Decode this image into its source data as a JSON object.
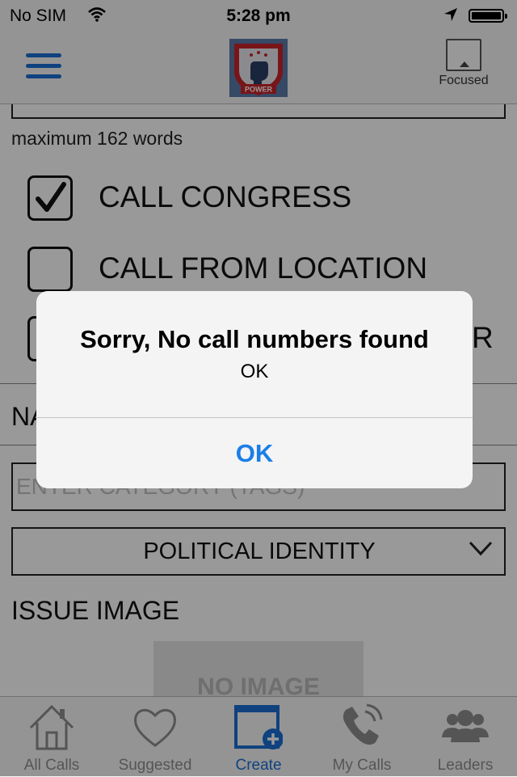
{
  "status_bar": {
    "carrier": "No SIM",
    "time": "5:28 pm"
  },
  "nav": {
    "logo_text": "POWER",
    "focused_label": "Focused"
  },
  "form": {
    "word_limit": "maximum 162 words",
    "checkboxes": [
      {
        "label": "CALL CONGRESS",
        "checked": true
      },
      {
        "label": "CALL FROM LOCATION",
        "checked": false
      },
      {
        "label": "R",
        "checked": false
      }
    ],
    "name_label": "NA",
    "category_placeholder": "ENTER CATEGORY (TAGS)",
    "identity_select": "POLITICAL IDENTITY",
    "issue_image_label": "ISSUE IMAGE",
    "no_image_text": "NO IMAGE"
  },
  "tabs": [
    {
      "label": "All Calls",
      "icon": "home-icon",
      "active": false
    },
    {
      "label": "Suggested",
      "icon": "heart-icon",
      "active": false
    },
    {
      "label": "Create",
      "icon": "create-icon",
      "active": true
    },
    {
      "label": "My Calls",
      "icon": "phone-icon",
      "active": false
    },
    {
      "label": "Leaders",
      "icon": "people-icon",
      "active": false
    }
  ],
  "alert": {
    "title": "Sorry, No call numbers found",
    "message": "OK",
    "button": "OK"
  },
  "colors": {
    "accent": "#1a6fd4",
    "alert_button": "#1a7ee8",
    "logo_red": "#c8242b"
  }
}
